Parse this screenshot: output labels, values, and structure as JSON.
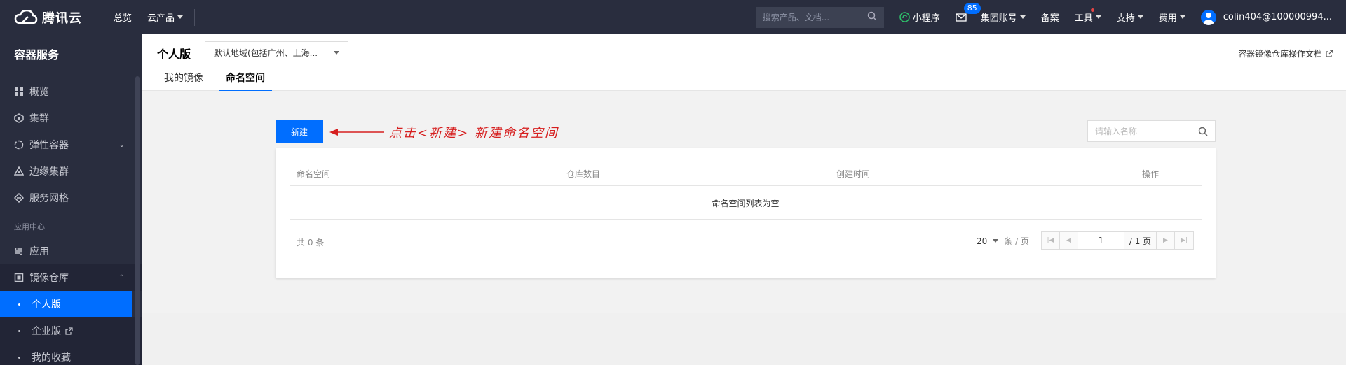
{
  "topbar": {
    "logo_text": "腾讯云",
    "nav_overview": "总览",
    "nav_products": "云产品",
    "search_placeholder": "搜索产品、文档...",
    "mini_program": "小程序",
    "mail_count": "85",
    "group_account": "集团账号",
    "beian": "备案",
    "tools": "工具",
    "support": "支持",
    "billing": "费用",
    "user": "colin404@100000994..."
  },
  "sidebar": {
    "title": "容器服务",
    "items": [
      {
        "label": "概览",
        "icon": "grid-icon"
      },
      {
        "label": "集群",
        "icon": "cluster-icon"
      },
      {
        "label": "弹性容器",
        "icon": "elastic-icon"
      },
      {
        "label": "边缘集群",
        "icon": "edge-icon"
      },
      {
        "label": "服务网格",
        "icon": "mesh-icon"
      }
    ],
    "group_label": "应用中心",
    "app_item": "应用",
    "registry_item": "镜像仓库",
    "sub_items": [
      {
        "label": "个人版",
        "active": true
      },
      {
        "label": "企业版",
        "active": false
      },
      {
        "label": "我的收藏",
        "active": false
      }
    ]
  },
  "header": {
    "title": "个人版",
    "region": "默认地域(包括广州、上海...",
    "doc_link": "容器镜像仓库操作文档",
    "tabs": [
      {
        "label": "我的镜像",
        "active": false
      },
      {
        "label": "命名空间",
        "active": true
      }
    ]
  },
  "main": {
    "new_button": "新建",
    "annotation": "点击<新建> 新建命名空间",
    "name_search_placeholder": "请输入名称",
    "columns": [
      "命名空间",
      "仓库数目",
      "创建时间",
      "操作"
    ],
    "empty_text": "命名空间列表为空",
    "total": "共 0 条",
    "page_size": "20",
    "page_size_unit": "条 / 页",
    "current_page": "1",
    "total_pages": "/ 1 页"
  },
  "colors": {
    "primary": "#006eff",
    "nav_bg": "#292d3e",
    "annotation": "#d61f1f"
  }
}
